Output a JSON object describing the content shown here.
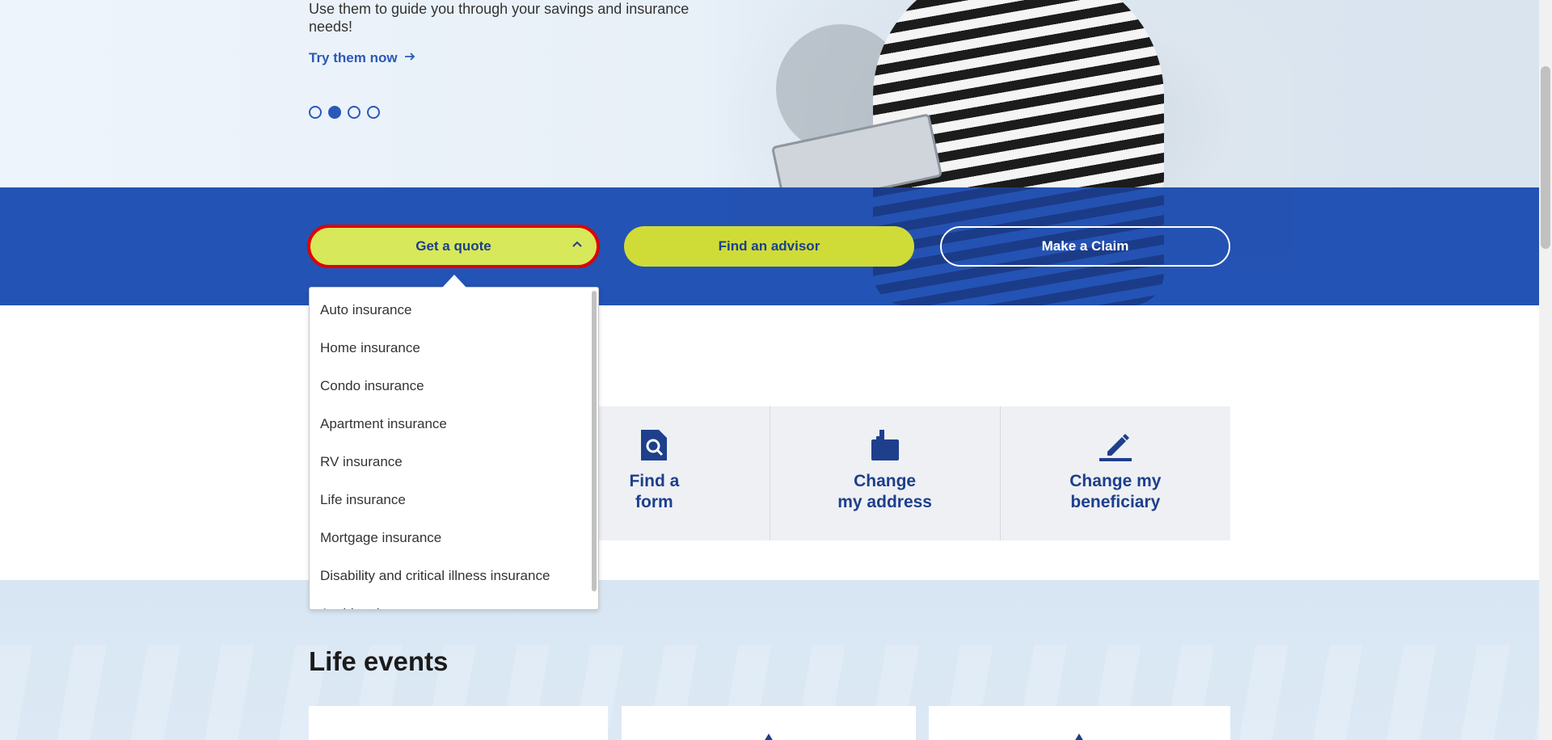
{
  "hero": {
    "description": "Use them to guide you through your savings and insurance needs!",
    "cta_label": "Try them now",
    "carousel": {
      "count": 4,
      "active_index": 1
    }
  },
  "band": {
    "quote_label": "Get a quote",
    "advisor_label": "Find an advisor",
    "claim_label": "Make a Claim"
  },
  "dropdown": {
    "items": [
      "Auto insurance",
      "Home insurance",
      "Condo insurance",
      "Apartment insurance",
      "RV insurance",
      "Life insurance",
      "Mortgage insurance",
      "Disability and critical illness insurance",
      "Accident insurance"
    ]
  },
  "actions": [
    {
      "label": "Find a\nform",
      "icon": "document-search-icon"
    },
    {
      "label": "Change\nmy address",
      "icon": "mailbox-icon"
    },
    {
      "label": "Change my\nbeneficiary",
      "icon": "pen-sign-icon"
    }
  ],
  "life_events": {
    "title": "Life events"
  },
  "colors": {
    "brand_blue": "#2353b5",
    "dark_blue": "#1d3f8c",
    "lime": "#d7e85a",
    "highlight_red": "#e00000"
  }
}
